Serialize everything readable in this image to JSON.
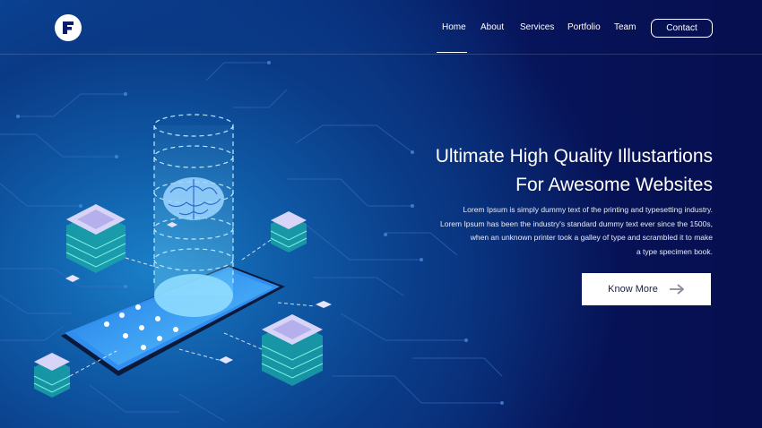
{
  "brand": {
    "logo_letter": "F"
  },
  "nav": {
    "items": [
      {
        "label": "Home",
        "active": true
      },
      {
        "label": "About"
      },
      {
        "label": "Services"
      },
      {
        "label": "Portfolio"
      },
      {
        "label": "Team"
      }
    ],
    "contact_label": "Contact"
  },
  "hero": {
    "title_line1": "Ultimate High Quality Illustartions",
    "title_line2": "For Awesome Websites",
    "body_lines": [
      "Lorem Ipsum is simply dummy text of the printing and typesetting industry.",
      "Lorem Ipsum has been the industry's standard dummy text ever since the 1500s,",
      "when an unknown printer took a galley of type and scrambled it to make",
      "a type specimen book."
    ],
    "cta_label": "Know More",
    "cta_icon": "arrow-right-icon"
  },
  "colors": {
    "background_dark": "#060f4f",
    "background_light": "#1a7fc8",
    "accent_cyan": "#7fe3ff",
    "chip_lilac": "#c8c4f2"
  }
}
